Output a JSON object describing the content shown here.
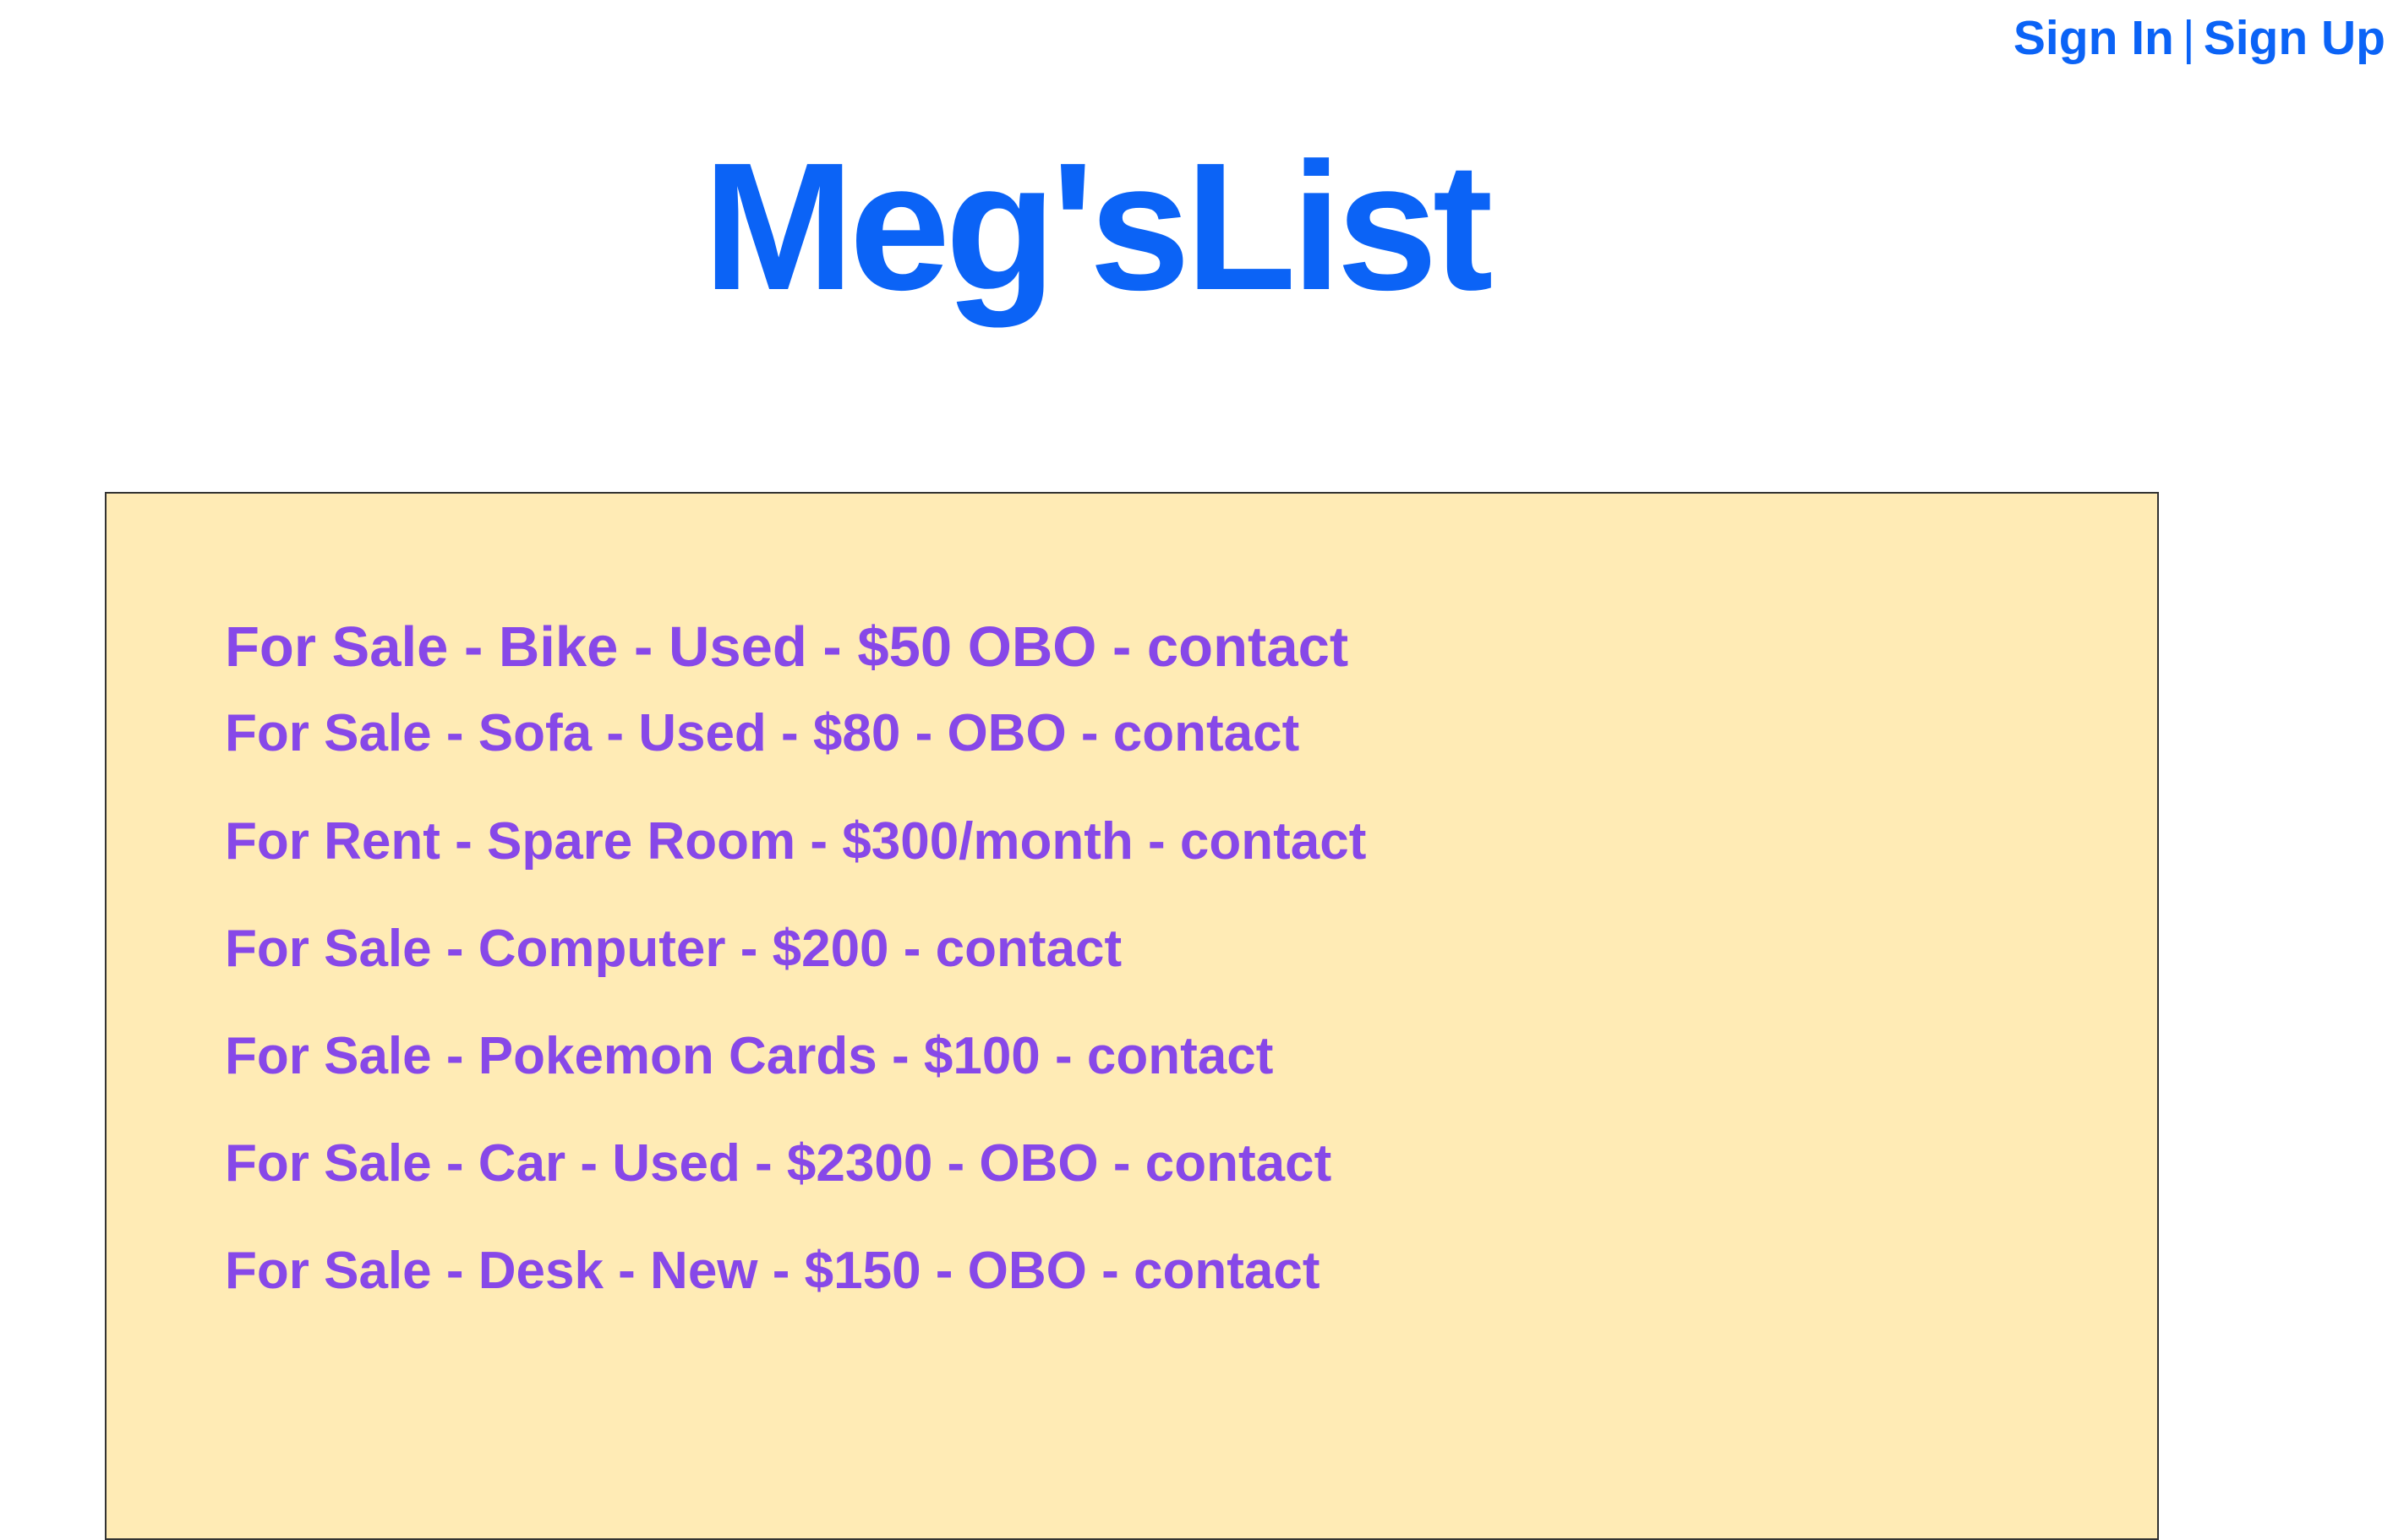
{
  "header": {
    "sign_in": "Sign In",
    "separator": "|",
    "sign_up": "Sign Up"
  },
  "site_title": "Meg'sList",
  "listings": [
    "For Sale - Bike - Used - $50 OBO - contact",
    "For Sale - Sofa - Used - $80 - OBO - contact",
    "For Rent - Spare Room - $300/month - contact",
    "For Sale - Computer - $200 - contact",
    "For Sale - Pokemon Cards - $100 - contact",
    "For Sale - Car - Used - $2300 - OBO - contact",
    "For Sale - Desk - New - $150 - OBO - contact"
  ],
  "colors": {
    "brand_blue": "#0b63f6",
    "listing_purple": "#8748e8",
    "panel_background": "#ffebb5"
  }
}
